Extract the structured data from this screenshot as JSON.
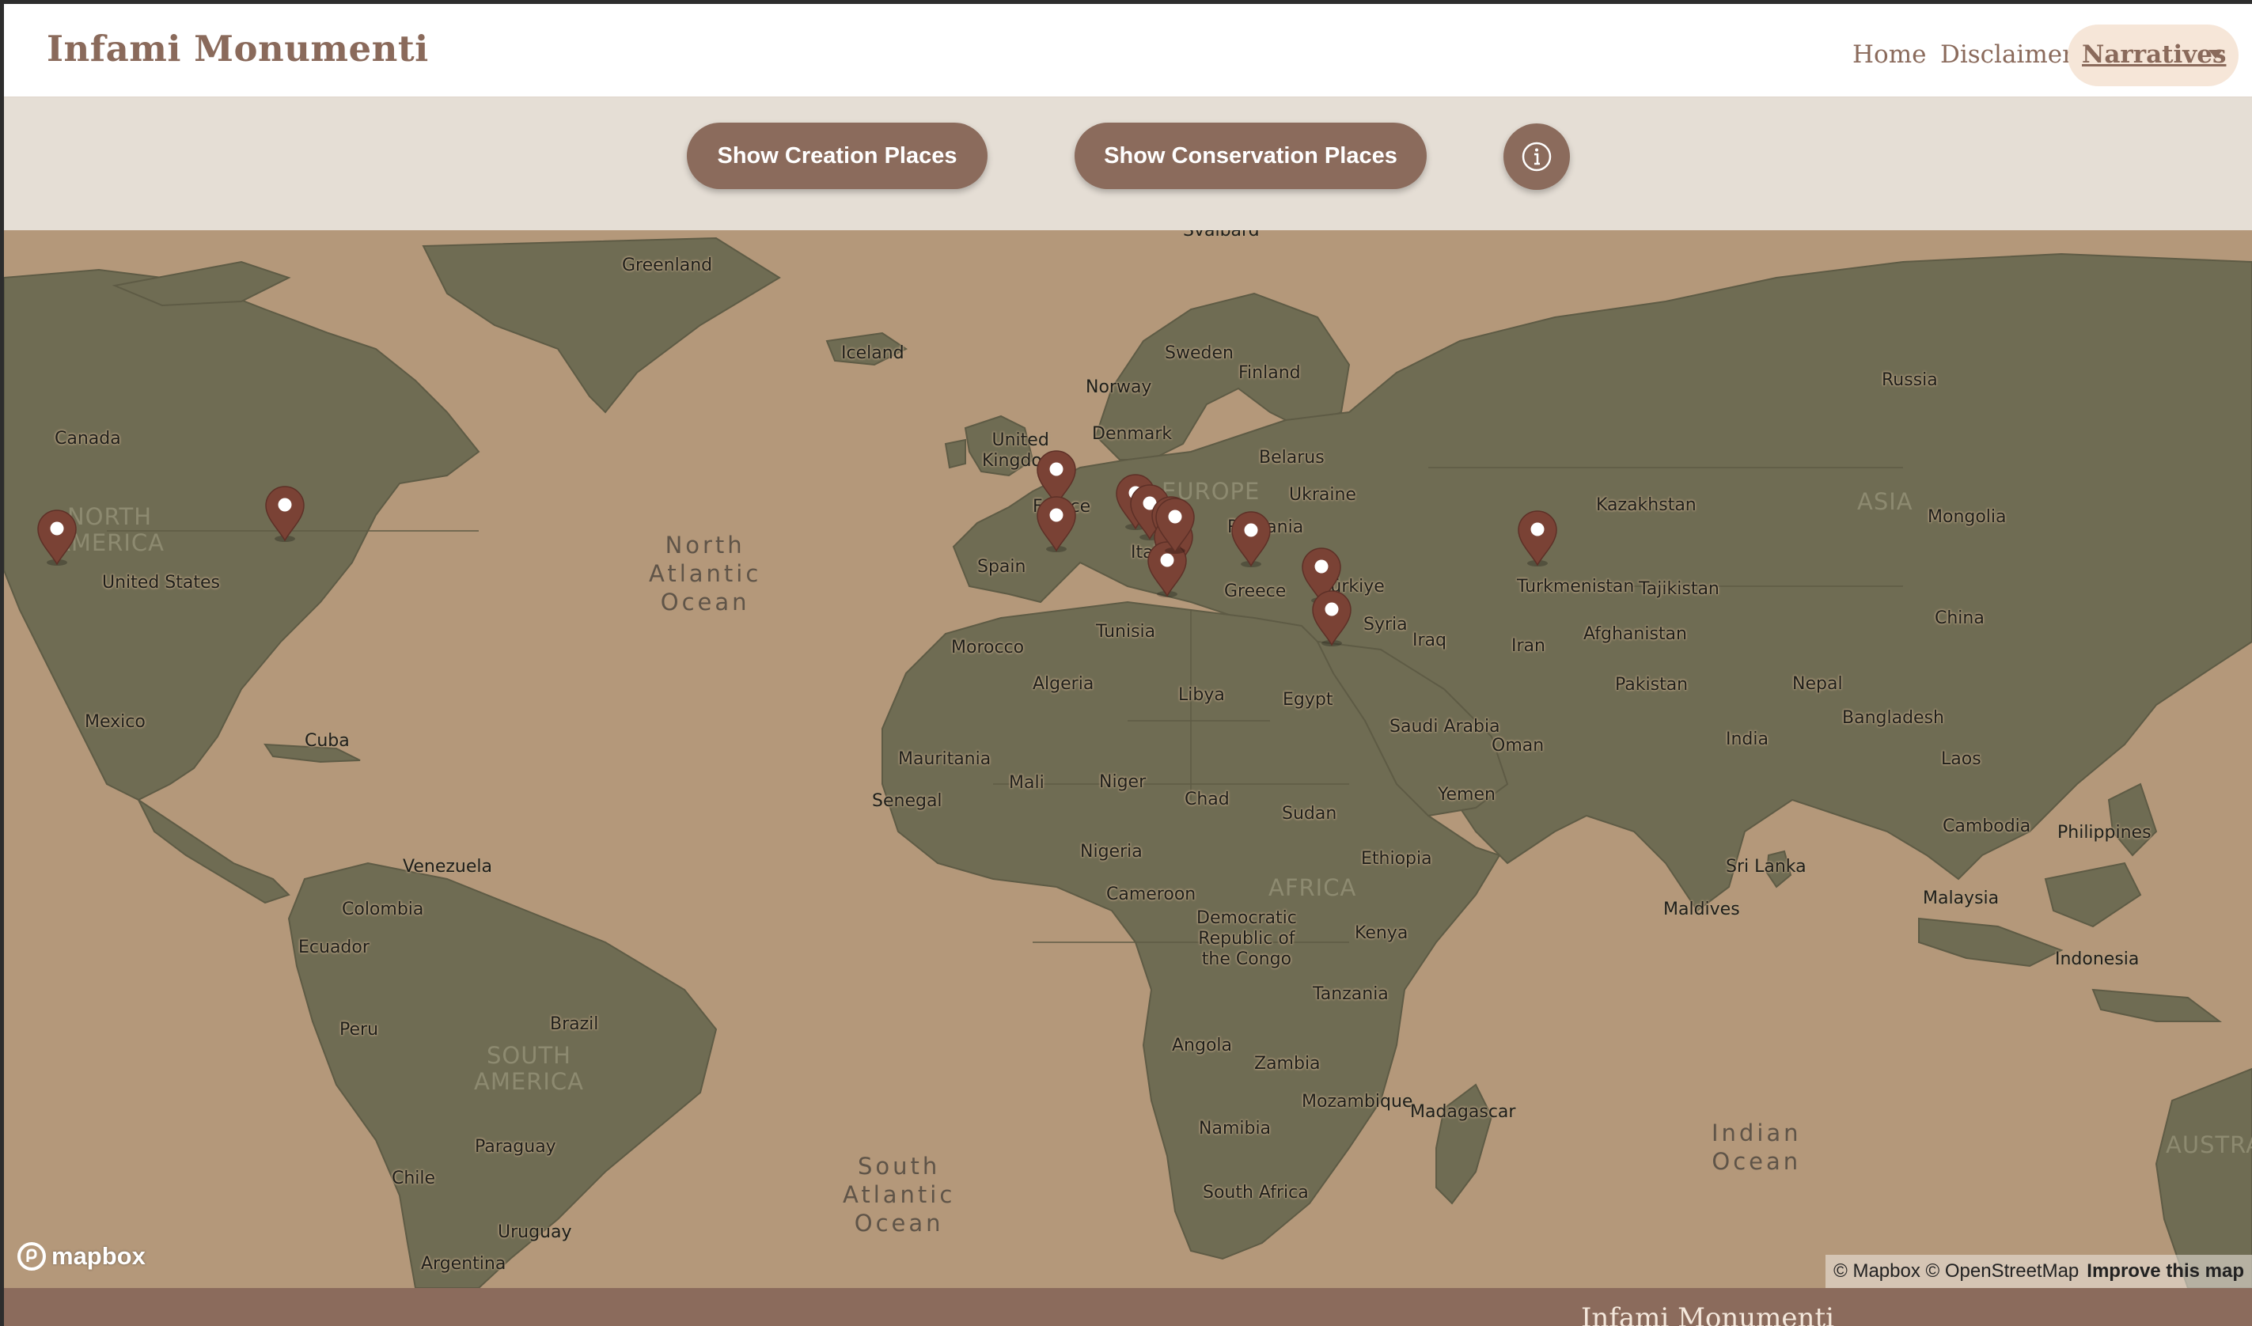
{
  "nav": {
    "brand": "Infami Monumenti",
    "links": [
      "Home",
      "Disclaimer"
    ],
    "dropdown_label": "Narratives"
  },
  "toolbar": {
    "creation_button": "Show Creation Places",
    "conservation_button": "Show Conservation Places",
    "info_icon": "info-icon"
  },
  "map": {
    "countries": {
      "svalbard": "Svalbard",
      "greenland": "Greenland",
      "iceland": "Iceland",
      "sweden": "Sweden",
      "finland": "Finland",
      "norway": "Norway",
      "russia": "Russia",
      "united_kingdom": "United\nKingdom",
      "denmark": "Denmark",
      "belarus": "Belarus",
      "ukraine": "Ukraine",
      "canada": "Canada",
      "kazakhstan": "Kazakhstan",
      "mongolia": "Mongolia",
      "france": "France",
      "romania": "Romania",
      "spain": "Spain",
      "italy": "Italy",
      "greece": "Greece",
      "turkiye": "Türkiye",
      "turkmenistan": "Turkmenistan",
      "tajikistan": "Tajikistan",
      "united_states": "United States",
      "syria": "Syria",
      "iraq": "Iraq",
      "afghanistan": "Afghanistan",
      "iran": "Iran",
      "china": "China",
      "tunisia": "Tunisia",
      "morocco": "Morocco",
      "pakistan": "Pakistan",
      "nepal": "Nepal",
      "algeria": "Algeria",
      "libya": "Libya",
      "egypt": "Egypt",
      "bangladesh": "Bangladesh",
      "mexico": "Mexico",
      "saudi_arabia": "Saudi Arabia",
      "oman": "Oman",
      "india": "India",
      "cuba": "Cuba",
      "mauritania": "Mauritania",
      "laos": "Laos",
      "mali": "Mali",
      "niger": "Niger",
      "senegal": "Senegal",
      "chad": "Chad",
      "yemen": "Yemen",
      "sudan": "Sudan",
      "cambodia": "Cambodia",
      "philippines": "Philippines",
      "nigeria": "Nigeria",
      "ethiopia": "Ethiopia",
      "venezuela": "Venezuela",
      "sri_lanka": "Sri Lanka",
      "cameroon": "Cameroon",
      "malaysia": "Malaysia",
      "colombia": "Colombia",
      "maldives": "Maldives",
      "drc": "Democratic\nRepublic of\nthe Congo",
      "kenya": "Kenya",
      "ecuador": "Ecuador",
      "indonesia": "Indonesia",
      "tanzania": "Tanzania",
      "peru": "Peru",
      "brazil": "Brazil",
      "angola": "Angola",
      "zambia": "Zambia",
      "mozambique": "Mozambique",
      "madagascar": "Madagascar",
      "namibia": "Namibia",
      "paraguay": "Paraguay",
      "chile": "Chile",
      "south_africa": "South Africa",
      "uruguay": "Uruguay",
      "argentina": "Argentina"
    },
    "oceans": {
      "north_atlantic": "North\nAtlantic\nOcean",
      "south_atlantic": "South\nAtlantic\nOcean",
      "indian": "Indian\nOcean"
    },
    "continents": {
      "north_america": "NORTH\nAMERICA",
      "europe": "EUROPE",
      "asia": "ASIA",
      "africa": "AFRICA",
      "south_america": "SOUTH\nAMERICA",
      "australia": "AUSTRA"
    },
    "marker_count": 14,
    "logo": "mapbox",
    "attribution": "© Mapbox © OpenStreetMap",
    "improve_link": "Improve this map"
  },
  "footer": {
    "brand": "Infami Monumenti"
  },
  "colors": {
    "brand": "#8a6a5b",
    "button": "#8b6b5c",
    "dropdown_bg": "#f6e6d8",
    "toolbar_bg": "#e5ded5",
    "ocean": "#b4987a",
    "land": "#6f6c53",
    "marker": "#7a4235"
  }
}
